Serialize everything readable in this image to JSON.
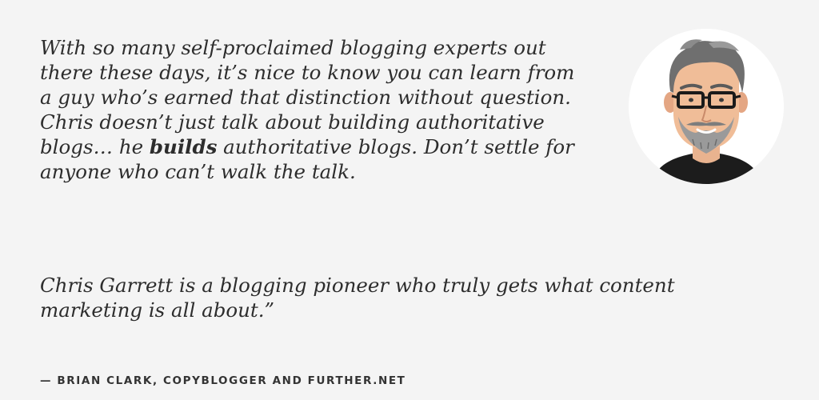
{
  "quote": {
    "paragraph1": {
      "line1": "With so many self-proclaimed blogging experts out",
      "line2": "there these days, it’s nice to know you can learn from",
      "line3": "a guy who’s earned that distinction without question.",
      "line4": "Chris doesn’t just talk about building authoritative",
      "line5_before": "blogs… he ",
      "line5_bold": "builds",
      "line5_after": " authoritative blogs. Don’t settle for",
      "line6": "anyone who can’t walk the talk."
    },
    "paragraph2": {
      "line1": "Chris Garrett is a blogging pioneer who truly gets what content",
      "line2": "marketing is all about.”"
    }
  },
  "attribution": "— BRIAN CLARK, COPYBLOGGER AND FURTHER.NET",
  "avatar": {
    "icon": "illustrated-portrait-icon"
  },
  "colors": {
    "background": "#f4f4f4",
    "text": "#2d2d2d",
    "avatar_bg": "#ffffff"
  }
}
